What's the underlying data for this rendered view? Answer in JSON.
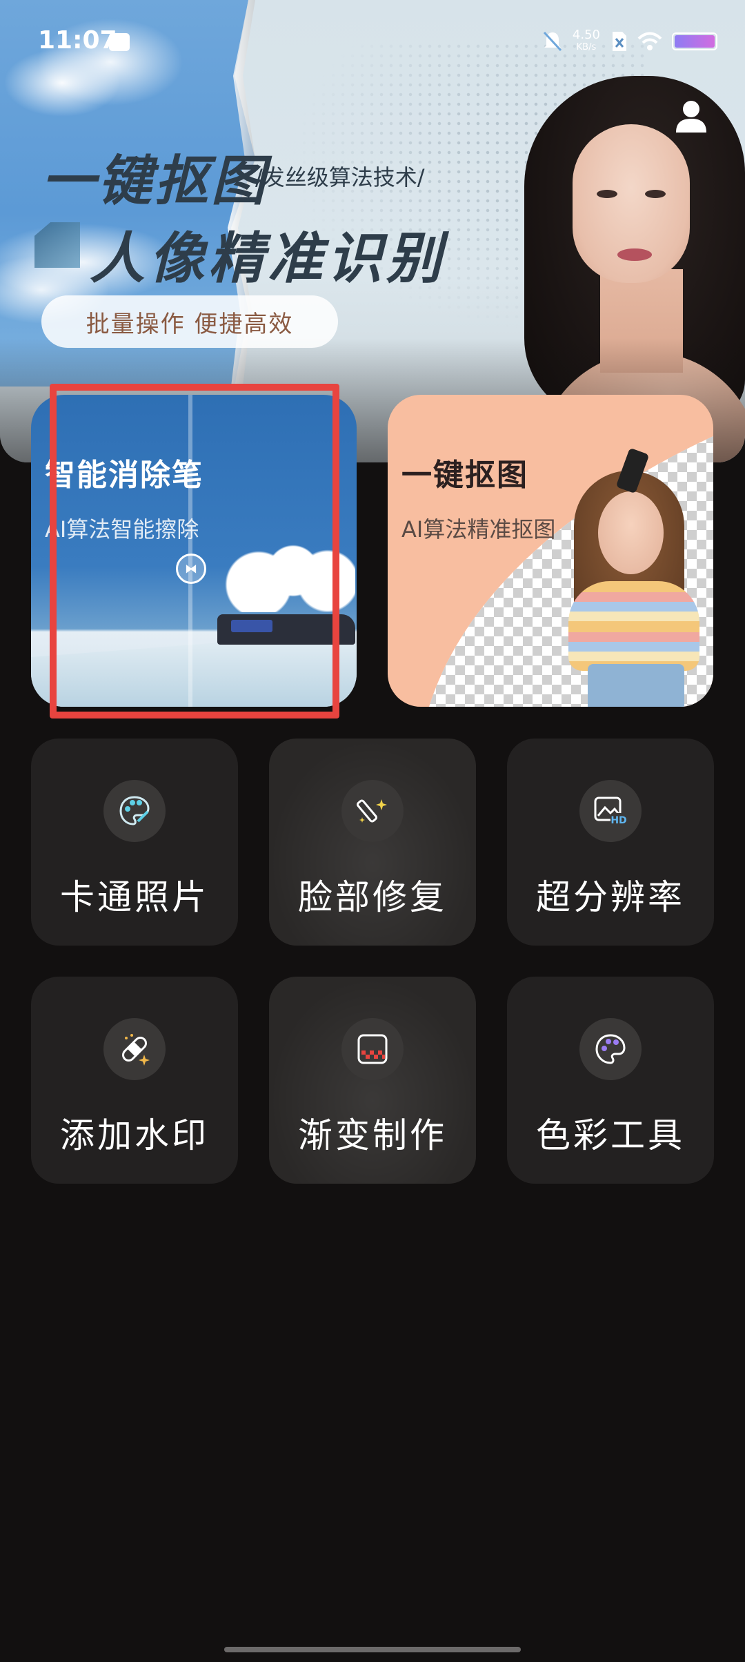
{
  "status_bar": {
    "time": "11:07",
    "speed_value": "4.50",
    "speed_unit": "KB/s"
  },
  "banner": {
    "title": "一键抠图",
    "tagline": "/发丝级算法技术/",
    "subtitle": "人像精准识别",
    "pill": "批量操作  便捷高效"
  },
  "feature_cards": [
    {
      "title": "智能消除笔",
      "desc": "AI算法智能擦除"
    },
    {
      "title": "一键抠图",
      "desc": "AI算法精准抠图"
    }
  ],
  "tools": [
    {
      "label": "卡通照片",
      "icon": "palette-icon"
    },
    {
      "label": "脸部修复",
      "icon": "magic-wand-icon"
    },
    {
      "label": "超分辨率",
      "icon": "hd-image-icon"
    },
    {
      "label": "添加水印",
      "icon": "bandage-icon"
    },
    {
      "label": "渐变制作",
      "icon": "gradient-icon"
    },
    {
      "label": "色彩工具",
      "icon": "color-palette-icon"
    }
  ],
  "colors": {
    "background": "#121010",
    "tile": "#232121",
    "highlight": "#e8443f",
    "cutout_card": "#f8bea0"
  }
}
